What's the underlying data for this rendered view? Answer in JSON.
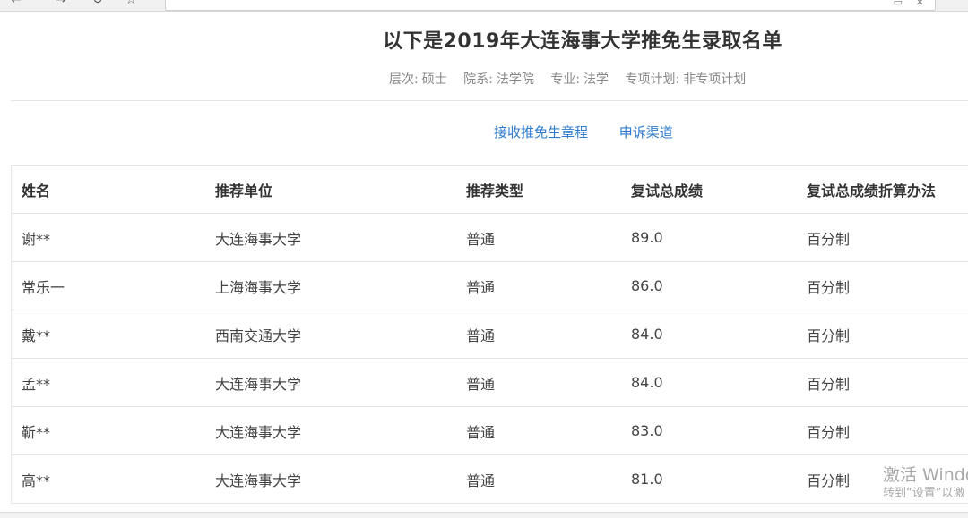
{
  "browser": {
    "back_icon": "←",
    "forward_icon": "→",
    "refresh_icon": "↻",
    "bookmark_icon": "☆",
    "reader_icon": "▭",
    "close_icon": "✕"
  },
  "header": {
    "title": "以下是2019年大连海事大学推免生录取名单",
    "meta": [
      {
        "label": "层次:",
        "value": "硕士"
      },
      {
        "label": "院系:",
        "value": "法学院"
      },
      {
        "label": "专业:",
        "value": "法学"
      },
      {
        "label": "专项计划:",
        "value": "非专项计划"
      }
    ]
  },
  "links": {
    "rules": "接收推免生章程",
    "appeal": "申诉渠道"
  },
  "table": {
    "headers": [
      "姓名",
      "推荐单位",
      "推荐类型",
      "复试总成绩",
      "复试总成绩折算办法"
    ],
    "rows": [
      [
        "谢**",
        "大连海事大学",
        "普通",
        "89.0",
        "百分制"
      ],
      [
        "常乐一",
        "上海海事大学",
        "普通",
        "86.0",
        "百分制"
      ],
      [
        "戴**",
        "西南交通大学",
        "普通",
        "84.0",
        "百分制"
      ],
      [
        "孟**",
        "大连海事大学",
        "普通",
        "84.0",
        "百分制"
      ],
      [
        "靳**",
        "大连海事大学",
        "普通",
        "83.0",
        "百分制"
      ],
      [
        "高**",
        "大连海事大学",
        "普通",
        "81.0",
        "百分制"
      ]
    ]
  },
  "watermark": {
    "line1": "激活 Windo",
    "line2": "转到“设置”以激"
  },
  "colors": {
    "link": "#2e7bcf",
    "text": "#333333",
    "muted": "#888888",
    "border": "#e6e6e6"
  }
}
